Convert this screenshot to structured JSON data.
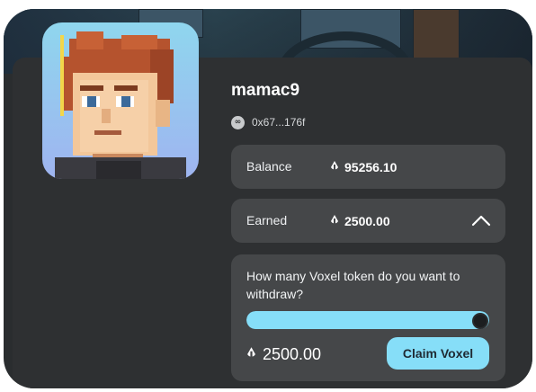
{
  "profile": {
    "username": "mamac9",
    "address": "0x67...176f",
    "address_icon": "link-icon"
  },
  "balance": {
    "label": "Balance",
    "value": "95256.10",
    "icon": "voxel-token-icon"
  },
  "earned": {
    "label": "Earned",
    "value": "2500.00",
    "icon": "voxel-token-icon",
    "expand_icon": "chevron-up-icon"
  },
  "withdraw": {
    "question": "How many Voxel token do you want to withdraw?",
    "slider_fraction": 1.0,
    "amount": "2500.00",
    "claim_label": "Claim Voxel"
  },
  "colors": {
    "accent": "#86def8",
    "panel": "#2e3032",
    "card": "#454749"
  }
}
